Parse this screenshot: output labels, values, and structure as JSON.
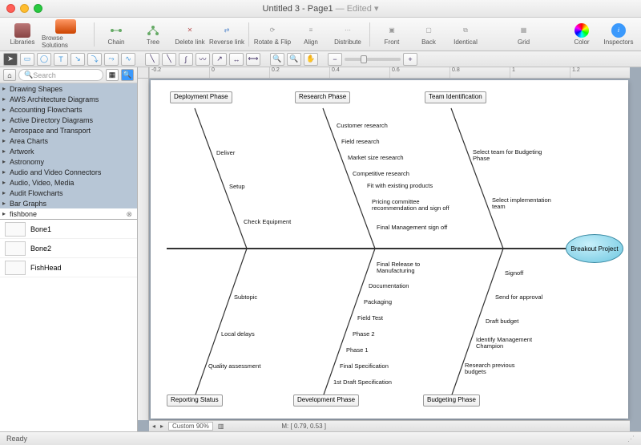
{
  "window": {
    "title_a": "Untitled 3 - Page1",
    "title_b": " — Edited",
    "close": "close",
    "min": "minimize",
    "max": "zoom"
  },
  "toolbar": {
    "libraries": "Libraries",
    "browse": "Browse Solutions",
    "chain": "Chain",
    "tree": "Tree",
    "delete_link": "Delete link",
    "reverse_link": "Reverse link",
    "rotate_flip": "Rotate & Flip",
    "align": "Align",
    "distribute": "Distribute",
    "front": "Front",
    "back": "Back",
    "identical": "Identical",
    "grid": "Grid",
    "color": "Color",
    "inspectors": "Inspectors"
  },
  "sidebar": {
    "search_placeholder": "Search",
    "libs": [
      "Drawing Shapes",
      "AWS Architecture Diagrams",
      "Accounting Flowcharts",
      "Active Directory Diagrams",
      "Aerospace and Transport",
      "Area Charts",
      "Artwork",
      "Astronomy",
      "Audio and Video Connectors",
      "Audio, Video, Media",
      "Audit Flowcharts",
      "Bar Graphs",
      "fishbone"
    ],
    "selected_lib": "fishbone",
    "shapes": [
      "Bone1",
      "Bone2",
      "FishHead"
    ]
  },
  "ruler_ticks": [
    "-0.2",
    "0",
    "0.2",
    "0.4",
    "0.6",
    "0.8",
    "1",
    "1.2"
  ],
  "diagram": {
    "head": "Breakout Project",
    "categories_top": [
      {
        "label": "Deployment Phase",
        "items": [
          "Deliver",
          "Setup",
          "Check Equipment"
        ]
      },
      {
        "label": "Research Phase",
        "items": [
          "Customer research",
          "Field research",
          "Market size research",
          "Competitive research",
          "Fit with existing products",
          "Pricing committee recommendation and sign off",
          "Final Management sign off"
        ]
      },
      {
        "label": "Team Identification",
        "items": [
          "Select team for Budgeting Phase",
          "Select implementation team"
        ]
      }
    ],
    "categories_bottom": [
      {
        "label": "Reporting Status",
        "items": [
          "Subtopic",
          "Local delays",
          "Quality assessment"
        ]
      },
      {
        "label": "Development Phase",
        "items": [
          "Final Release to Manufacturing",
          "Documentation",
          "Packaging",
          "Field Test",
          "Phase 2",
          "Phase 1",
          "Final Specification",
          "1st Draft Specification"
        ]
      },
      {
        "label": "Budgeting Phase",
        "items": [
          "Signoff",
          "Send for approval",
          "Draft budget",
          "Identify Management Champion",
          "Research previous budgets"
        ]
      }
    ]
  },
  "footer": {
    "zoom_mode": "Custom 90%",
    "cursor": "M: [ 0.79, 0.53 ]"
  },
  "status": {
    "ready": "Ready"
  }
}
